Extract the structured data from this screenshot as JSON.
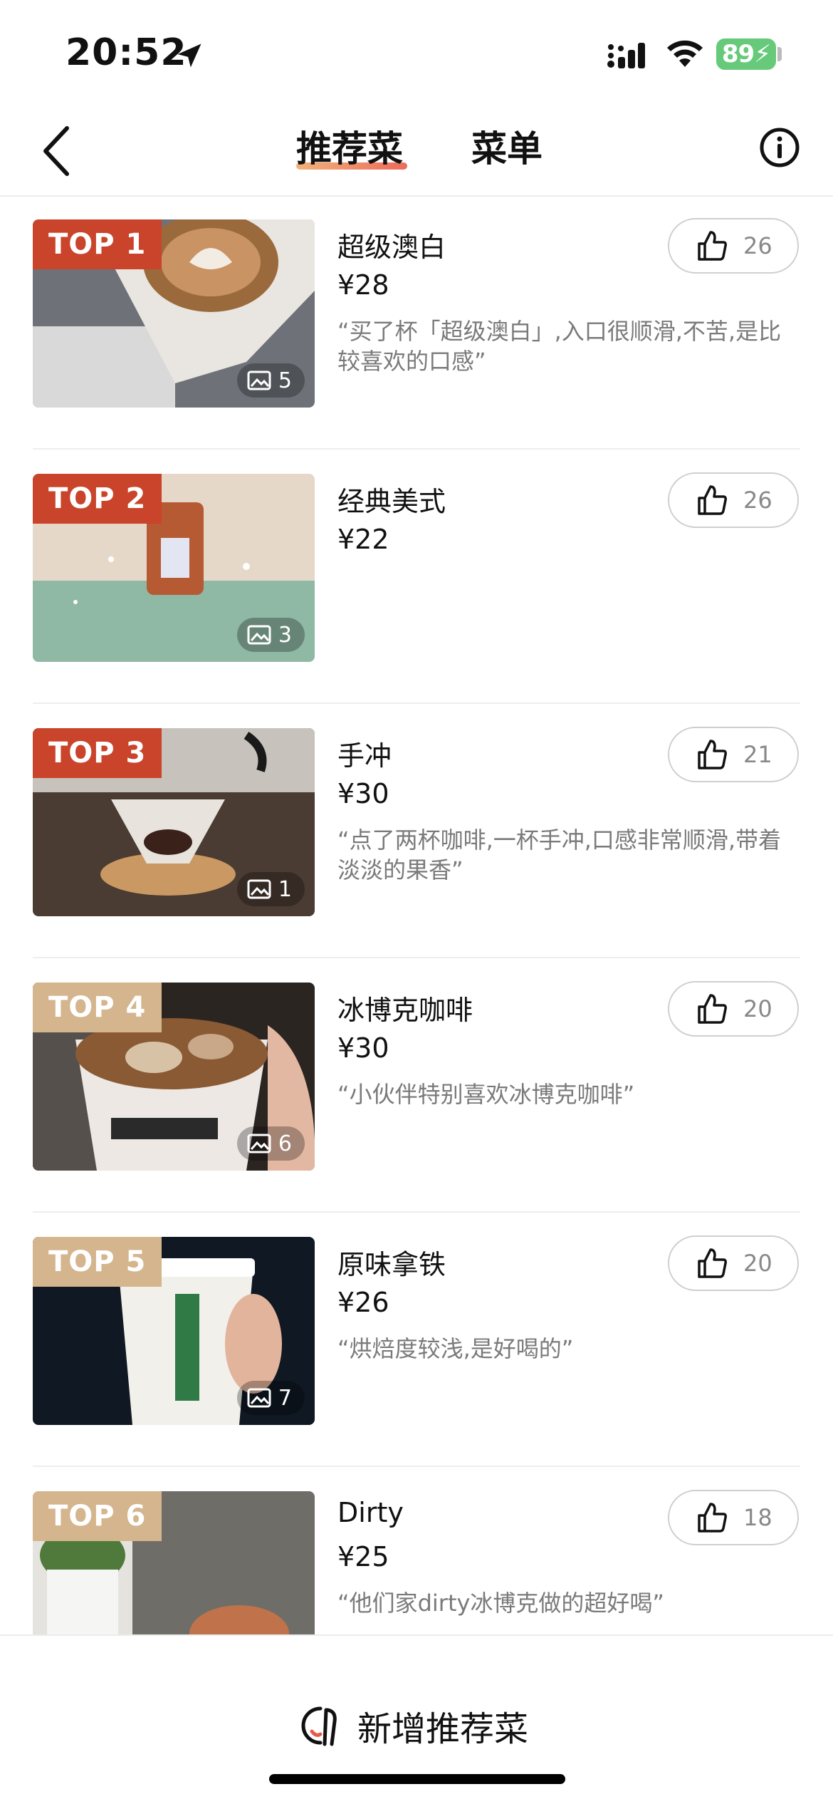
{
  "status_bar": {
    "time": "20:52",
    "battery": "89"
  },
  "nav": {
    "tab_recommended": "推荐菜",
    "tab_menu": "菜单"
  },
  "dishes": [
    {
      "rank": "TOP 1",
      "name": "超级澳白",
      "price": "¥28",
      "review": "“买了杯「超级澳白」,入口很顺滑,不苦,是比较喜欢的口感”",
      "likes": "26",
      "photos": "5",
      "badge_style": "hot"
    },
    {
      "rank": "TOP 2",
      "name": "经典美式",
      "price": "¥22",
      "review": "",
      "likes": "26",
      "photos": "3",
      "badge_style": "hot"
    },
    {
      "rank": "TOP 3",
      "name": "手冲",
      "price": "¥30",
      "review": "“点了两杯咖啡,一杯手冲,口感非常顺滑,带着淡淡的果香”",
      "likes": "21",
      "photos": "1",
      "badge_style": "hot"
    },
    {
      "rank": "TOP 4",
      "name": "冰博克咖啡",
      "price": "¥30",
      "review": "“小伙伴特别喜欢冰博克咖啡”",
      "likes": "20",
      "photos": "6",
      "badge_style": "normal"
    },
    {
      "rank": "TOP 5",
      "name": "原味拿铁",
      "price": "¥26",
      "review": "“烘焙度较浅,是好喝的”",
      "likes": "20",
      "photos": "7",
      "badge_style": "normal"
    },
    {
      "rank": "TOP 6",
      "name": "Dirty",
      "price": "¥25",
      "review": "“他们家dirty冰博克做的超好喝”",
      "likes": "18",
      "photos": "",
      "badge_style": "normal"
    }
  ],
  "bottom": {
    "add_label": "新增推荐菜"
  },
  "colors": {
    "hot_badge": "#c9442a",
    "normal_badge": "#d4b58e",
    "accent_gradient_start": "#f2b27a",
    "accent_gradient_end": "#ec6b5b"
  }
}
